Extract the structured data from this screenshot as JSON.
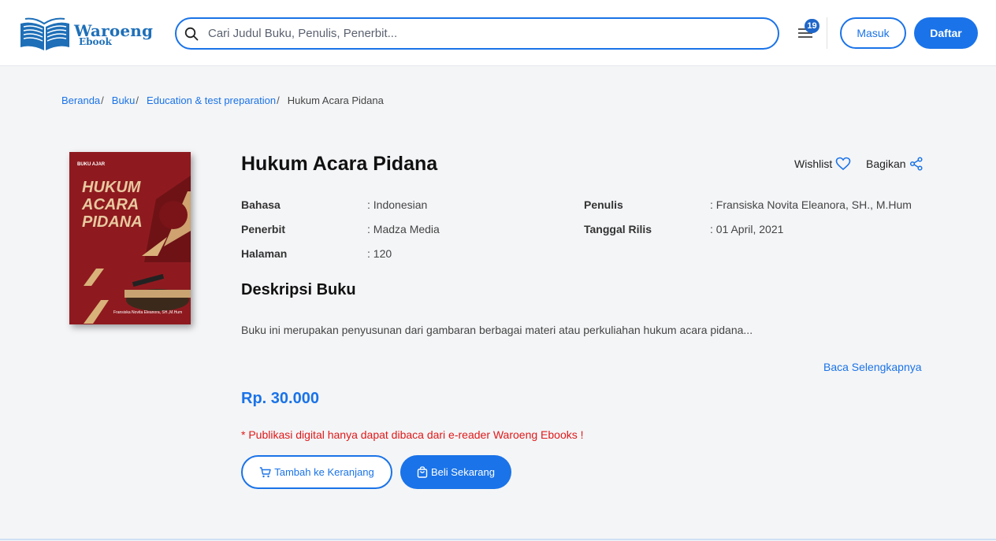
{
  "header": {
    "logo_name": "Waroeng",
    "logo_sub": "Ebook",
    "search_placeholder": "Cari Judul Buku, Penulis, Penerbit...",
    "menu_badge": "19",
    "login_label": "Masuk",
    "register_label": "Daftar"
  },
  "breadcrumb": {
    "items": [
      "Beranda",
      "Buku",
      "Education & test preparation"
    ],
    "current": "Hukum Acara Pidana"
  },
  "book": {
    "cover_label": "BUKU AJAR",
    "cover_title_lines": [
      "HUKUM",
      "ACARA",
      "PIDANA"
    ],
    "cover_author": "Fransiska Novita Eleanora, SH.,M.Hum",
    "title": "Hukum Acara Pidana",
    "wishlist_label": "Wishlist",
    "share_label": "Bagikan",
    "meta": {
      "bahasa_label": "Bahasa",
      "bahasa_value": ": Indonesian",
      "penerbit_label": "Penerbit",
      "penerbit_value": ": Madza Media",
      "halaman_label": "Halaman",
      "halaman_value": ": 120",
      "penulis_label": "Penulis",
      "penulis_value": ": Fransiska Novita Eleanora, SH., M.Hum",
      "rilis_label": "Tanggal Rilis",
      "rilis_value": ": 01 April, 2021"
    },
    "description_heading": "Deskripsi Buku",
    "description": "Buku ini merupakan penyusunan dari gambaran berbagai materi atau perkuliahan hukum acara pidana...",
    "read_more": "Baca Selengkapnya",
    "price": "Rp. 30.000",
    "notice": "* Publikasi digital hanya dapat dibaca dari e-reader Waroeng Ebooks !",
    "add_to_cart_label": "Tambah ke Keranjang",
    "buy_now_label": "Beli Sekarang"
  },
  "colors": {
    "accent": "#1a73e8",
    "cover_red": "#8e1a1f",
    "notice_red": "#e01919",
    "page_bg": "#f4f5f7"
  },
  "icons": [
    "book-logo-icon",
    "search-icon",
    "menu-icon",
    "heart-icon",
    "share-icon",
    "cart-icon",
    "bag-icon"
  ]
}
